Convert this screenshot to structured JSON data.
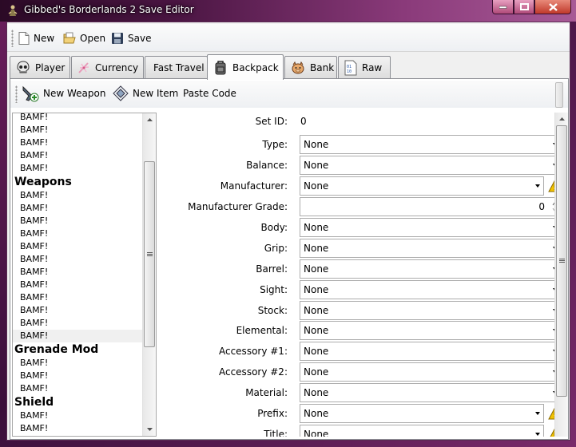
{
  "window": {
    "title": "Gibbed's Borderlands 2 Save Editor"
  },
  "toolbar": {
    "new_label": "New",
    "open_label": "Open",
    "save_label": "Save"
  },
  "tabs": [
    {
      "label": "Player",
      "icon": "skull-icon"
    },
    {
      "label": "Currency",
      "icon": "currency-icon"
    },
    {
      "label": "Fast Travel",
      "icon": ""
    },
    {
      "label": "Backpack",
      "icon": "backpack-icon",
      "active": true
    },
    {
      "label": "Bank",
      "icon": "bank-icon"
    },
    {
      "label": "Raw",
      "icon": "raw-data-icon"
    }
  ],
  "backpack": {
    "toolbar": {
      "new_weapon_label": "New Weapon",
      "new_item_label": "New Item",
      "paste_code_label": "Paste Code"
    },
    "list": {
      "top_items": [
        "BAMF!",
        "BAMF!",
        "BAMF!",
        "BAMF!",
        "BAMF!"
      ],
      "weapons_header": "Weapons",
      "weapons": [
        "BAMF!",
        "BAMF!",
        "BAMF!",
        "BAMF!",
        "BAMF!",
        "BAMF!",
        "BAMF!",
        "BAMF!",
        "BAMF!",
        "BAMF!",
        "BAMF!",
        "BAMF!"
      ],
      "grenade_header": "Grenade Mod",
      "grenades": [
        "BAMF!",
        "BAMF!",
        "BAMF!"
      ],
      "shield_header": "Shield",
      "shields": [
        "BAMF!",
        "BAMF!"
      ]
    },
    "form": {
      "set_id_label": "Set ID:",
      "set_id_value": "0",
      "type_label": "Type:",
      "type_value": "None",
      "balance_label": "Balance:",
      "balance_value": "None",
      "manufacturer_label": "Manufacturer:",
      "manufacturer_value": "None",
      "manufacturer_grade_label": "Manufacturer Grade:",
      "manufacturer_grade_value": "0",
      "body_label": "Body:",
      "body_value": "None",
      "grip_label": "Grip:",
      "grip_value": "None",
      "barrel_label": "Barrel:",
      "barrel_value": "None",
      "sight_label": "Sight:",
      "sight_value": "None",
      "stock_label": "Stock:",
      "stock_value": "None",
      "elemental_label": "Elemental:",
      "elemental_value": "None",
      "accessory1_label": "Accessory #1:",
      "accessory1_value": "None",
      "accessory2_label": "Accessory #2:",
      "accessory2_value": "None",
      "material_label": "Material:",
      "material_value": "None",
      "prefix_label": "Prefix:",
      "prefix_value": "None",
      "title_label": "Title:",
      "title_value": "None"
    }
  },
  "colors": {
    "titlebar_accent": "#8a3a7a",
    "close_button": "#c0392b",
    "warning": "#f2c200"
  }
}
